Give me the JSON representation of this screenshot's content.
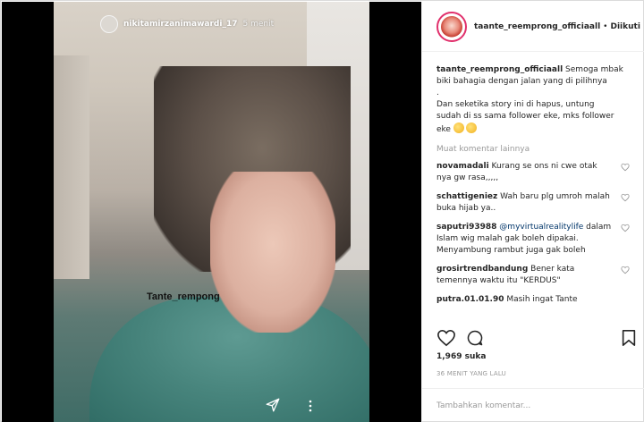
{
  "story": {
    "username": "nikitamirzanimawardi_17",
    "time": "5 menit",
    "watermark": "Tante_rempong"
  },
  "post": {
    "author": "taante_reemprong_officiaall",
    "follow_status": "Diikuti",
    "caption_lines": [
      "Semoga mbak",
      "biki bahagia dengan jalan yang di pilihnya",
      ".",
      "Dan seketika story ini di hapus, untung",
      "sudah di ss sama follower eke, mks follower",
      "eke"
    ],
    "load_more": "Muat komentar lainnya",
    "comments": [
      {
        "user": "novamadali",
        "text": "Kurang se ons ni cwe otak nya gw rasa,,,,,"
      },
      {
        "user": "schattigeniez",
        "text": "Wah baru plg umroh malah buka hijab ya.."
      },
      {
        "user": "saputri93988",
        "mention": "@myvirtualrealitylife",
        "text": "dalam Islam wig malah gak boleh dipakai. Menyambung rambut juga gak boleh"
      },
      {
        "user": "grosirtrendbandung",
        "text": "Bener kata temennya waktu itu \"KERDUS\""
      },
      {
        "user": "putra.01.01.90",
        "text": "Masih ingat Tante"
      }
    ],
    "likes": "1,969 suka",
    "time_ago": "36 MENIT YANG LALU",
    "comment_placeholder": "Tambahkan komentar..."
  },
  "colors": {
    "story_ring": "#e1306c",
    "mention": "#003569",
    "muted": "#999999"
  }
}
